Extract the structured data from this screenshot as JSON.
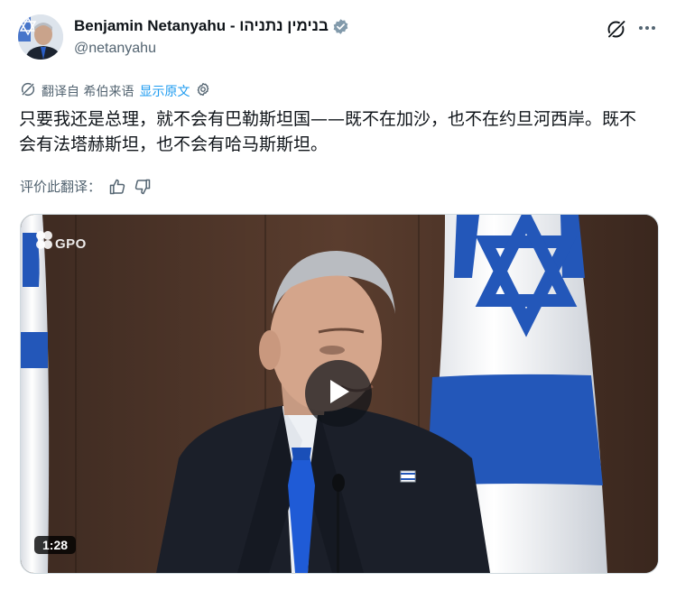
{
  "author": {
    "display_name": "Benjamin Netanyahu - בנימין נתניהו",
    "handle": "@netanyahu"
  },
  "header": {
    "grok_icon": "grok-icon",
    "more_icon": "more-horizontal-icon"
  },
  "translation": {
    "translated_from": "翻译自 希伯来语",
    "show_original": "显示原文",
    "rate_label": "评价此翻译：",
    "thumbs_up_icon": "thumbs-up-icon",
    "thumbs_down_icon": "thumbs-down-icon"
  },
  "tweet": {
    "text": "只要我还是总理，就不会有巴勒斯坦国——既不在加沙，也不在约旦河西岸。既不会有法塔赫斯坦，也不会有哈马斯斯坦。"
  },
  "media": {
    "duration": "1:28",
    "watermark": "GPO",
    "play_icon": "play-icon"
  },
  "colors": {
    "accent": "#1d9bf0",
    "secondary_text": "#536471",
    "primary_text": "#0f1419",
    "flag_blue": "#2357b9"
  }
}
